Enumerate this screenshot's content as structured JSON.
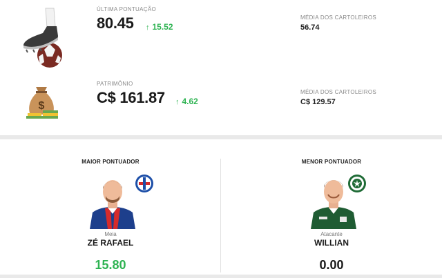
{
  "last_score": {
    "label": "ÚLTIMA PONTUAÇÃO",
    "value": "80.45",
    "delta": "15.52",
    "delta_direction": "up",
    "avg_label": "MÉDIA DOS CARTOLEIROS",
    "avg_value": "56.74",
    "icon": "soccer-boot-ball-icon"
  },
  "patrimony": {
    "label": "PATRIMÔNIO",
    "value": "C$ 161.87",
    "delta": "4.62",
    "delta_direction": "up",
    "avg_label": "MÉDIA DOS CARTOLEIROS",
    "avg_value": "C$ 129.57",
    "icon": "money-bag-icon"
  },
  "top_scorer": {
    "title": "MAIOR PONTUADOR",
    "position": "Meia",
    "name": "ZÉ RAFAEL",
    "score": "15.80",
    "crest": "bahia-crest-icon"
  },
  "lowest_scorer": {
    "title": "MENOR PONTUADOR",
    "position": "Atacante",
    "name": "WILLIAN",
    "score": "0.00",
    "crest": "palmeiras-crest-icon"
  },
  "colors": {
    "positive": "#2eb352",
    "text": "#1a1a1a",
    "muted": "#888888"
  }
}
